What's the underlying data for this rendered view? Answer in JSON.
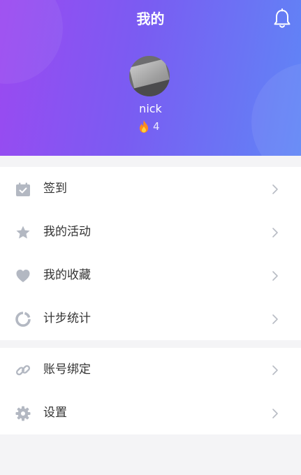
{
  "header": {
    "title": "我的",
    "username": "nick",
    "score": "4",
    "bell_icon": "bell-icon",
    "flame_icon": "flame-icon"
  },
  "menu_group_1": [
    {
      "label": "签到",
      "icon": "calendar-check-icon"
    },
    {
      "label": "我的活动",
      "icon": "star-icon"
    },
    {
      "label": "我的收藏",
      "icon": "heart-icon"
    },
    {
      "label": "计步统计",
      "icon": "ring-progress-icon"
    }
  ],
  "menu_group_2": [
    {
      "label": "账号绑定",
      "icon": "link-icon"
    },
    {
      "label": "设置",
      "icon": "gear-icon"
    }
  ],
  "colors": {
    "gradient_start": "#9b49f1",
    "gradient_end": "#5f86f6",
    "icon_gray": "#b3b8c2",
    "text": "#333333"
  }
}
